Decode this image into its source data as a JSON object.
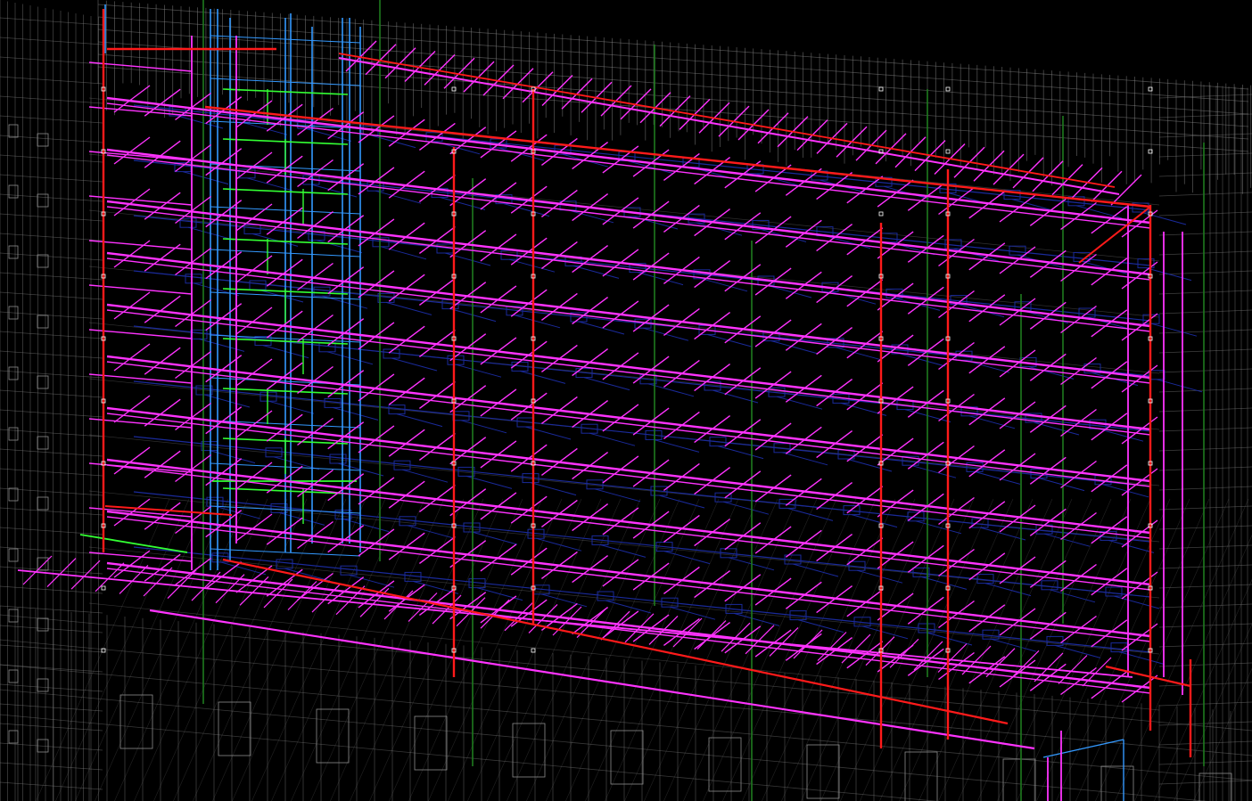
{
  "viewport": {
    "background": "#000000"
  },
  "systems": [
    {
      "id": "building-wireframe",
      "color": "#8c8c8c"
    },
    {
      "id": "sprinkler-branch-pipes",
      "color": "#ff33ff"
    },
    {
      "id": "fire-main-pipes",
      "color": "#ff1a1a"
    },
    {
      "id": "duct-work",
      "color": "#1a2a9a"
    },
    {
      "id": "shaft-risers",
      "color": "#3399ff"
    },
    {
      "id": "plumbing-lines",
      "color": "#33ff33"
    },
    {
      "id": "vertical-drains",
      "color": "#1e7a1e"
    }
  ]
}
